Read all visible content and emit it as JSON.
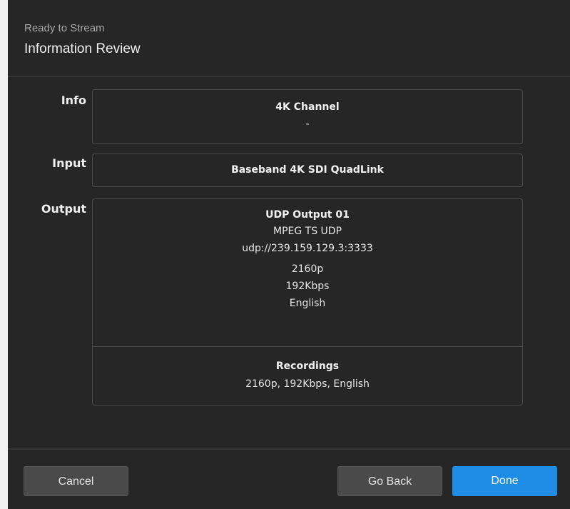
{
  "header": {
    "kicker": "Ready to Stream",
    "title": "Information Review"
  },
  "info": {
    "label": "Info",
    "name": "4K Channel",
    "description": "-"
  },
  "input": {
    "label": "Input",
    "name": "Baseband 4K SDI QuadLink"
  },
  "output": {
    "label": "Output",
    "name": "UDP Output 01",
    "type": "MPEG TS UDP",
    "address": "udp://239.159.129.3:3333",
    "resolution": "2160p",
    "bitrate": "192Kbps",
    "language": "English",
    "recordings_title": "Recordings",
    "recordings_detail": "2160p, 192Kbps, English"
  },
  "footer": {
    "cancel_label": "Cancel",
    "back_label": "Go Back",
    "done_label": "Done"
  },
  "colors": {
    "primary": "#1f8de6",
    "panel": "#262626"
  }
}
